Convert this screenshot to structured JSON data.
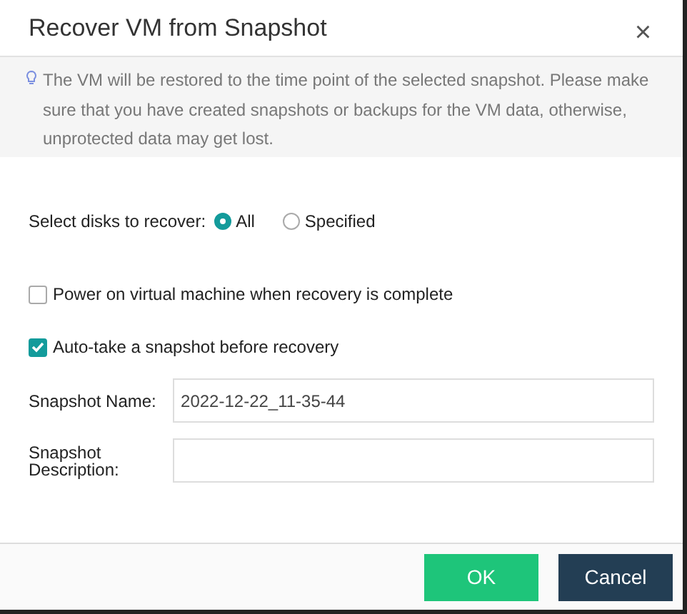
{
  "dialog": {
    "title": "Recover VM from Snapshot",
    "close": "×"
  },
  "notice": "The VM will be restored to the time point of the selected snapshot. Please make sure that you have created snapshots or backups for the VM data, otherwise, unprotected data may get lost.",
  "disk_select": {
    "label": "Select disks to recover:",
    "options": [
      {
        "label": "All",
        "selected": true
      },
      {
        "label": "Specified",
        "selected": false
      }
    ]
  },
  "checkboxes": [
    {
      "label": "Power on virtual machine when recovery is complete",
      "checked": false
    },
    {
      "label": "Auto-take a snapshot before recovery",
      "checked": true
    }
  ],
  "fields": [
    {
      "label": "Snapshot Name:",
      "value": "2022-12-22_11-35-44"
    },
    {
      "label": "Snapshot Description:"
    }
  ],
  "buttons": [
    {
      "label": "OK",
      "kind": "primary"
    },
    {
      "label": "Cancel",
      "kind": "secondary"
    }
  ]
}
